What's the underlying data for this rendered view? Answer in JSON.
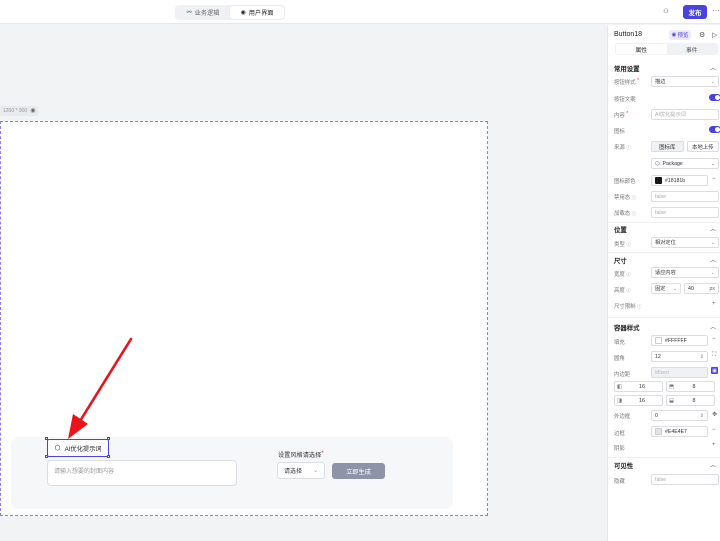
{
  "topbar": {
    "tabs": [
      {
        "label": "业务逻辑",
        "icon": "flow-icon"
      },
      {
        "label": "用户界面",
        "icon": "eye-icon"
      }
    ],
    "publish_label": "发布",
    "more_label": "···"
  },
  "canvas": {
    "size_label": "1200 * 900",
    "component": {
      "ai_button_label": "AI优化提示词",
      "textarea_placeholder": "请输入想要的封面内容",
      "style_label": "设置风格请选择",
      "style_required": "*",
      "select_value": "请选择",
      "generate_label": "立即生成"
    }
  },
  "panel": {
    "title": "Button18",
    "preview_label": "预览",
    "tabs": [
      "属性",
      "事件"
    ],
    "common": {
      "header": "常用设置",
      "btn_style_label": "按钮样式",
      "btn_style_value": "描边",
      "btn_text_label": "按钮文案",
      "content_label": "内容",
      "content_value": "AI优化提示词",
      "icon_label": "图标",
      "source_label": "来源",
      "source_options": [
        "图标库",
        "本地上传"
      ],
      "icon_value": "Package",
      "icon_color_label": "图标颜色",
      "icon_color_value": "#18181b",
      "disabled_label": "禁用态",
      "disabled_value": "false",
      "loading_label": "加载态",
      "loading_value": "false"
    },
    "position": {
      "header": "位置",
      "type_label": "类型",
      "type_value": "相对定位"
    },
    "size": {
      "header": "尺寸",
      "width_label": "宽度",
      "width_value": "适应内容",
      "height_label": "高度",
      "height_mode": "固定",
      "height_value": "40",
      "height_unit": "px",
      "limit_label": "尺寸限制"
    },
    "container": {
      "header": "容器样式",
      "fill_label": "填充",
      "fill_value": "#FFFFFF",
      "radius_label": "圆角",
      "radius_value": "12",
      "padding_label": "内边距",
      "padding_value": "Mixed",
      "paddings": [
        "16",
        "8",
        "16",
        "8"
      ],
      "border_width_label": "外边框",
      "border_width_value": "0",
      "border_label": "边框",
      "border_value": "#E4E4E7",
      "shadow_label": "阴影"
    },
    "visibility": {
      "header": "可见性",
      "hidden_label": "隐藏",
      "hidden_value": "false"
    }
  },
  "colors": {
    "accent": "#4b43e0",
    "arrow": "#e8141a",
    "generate_button": "#8e94a8"
  }
}
